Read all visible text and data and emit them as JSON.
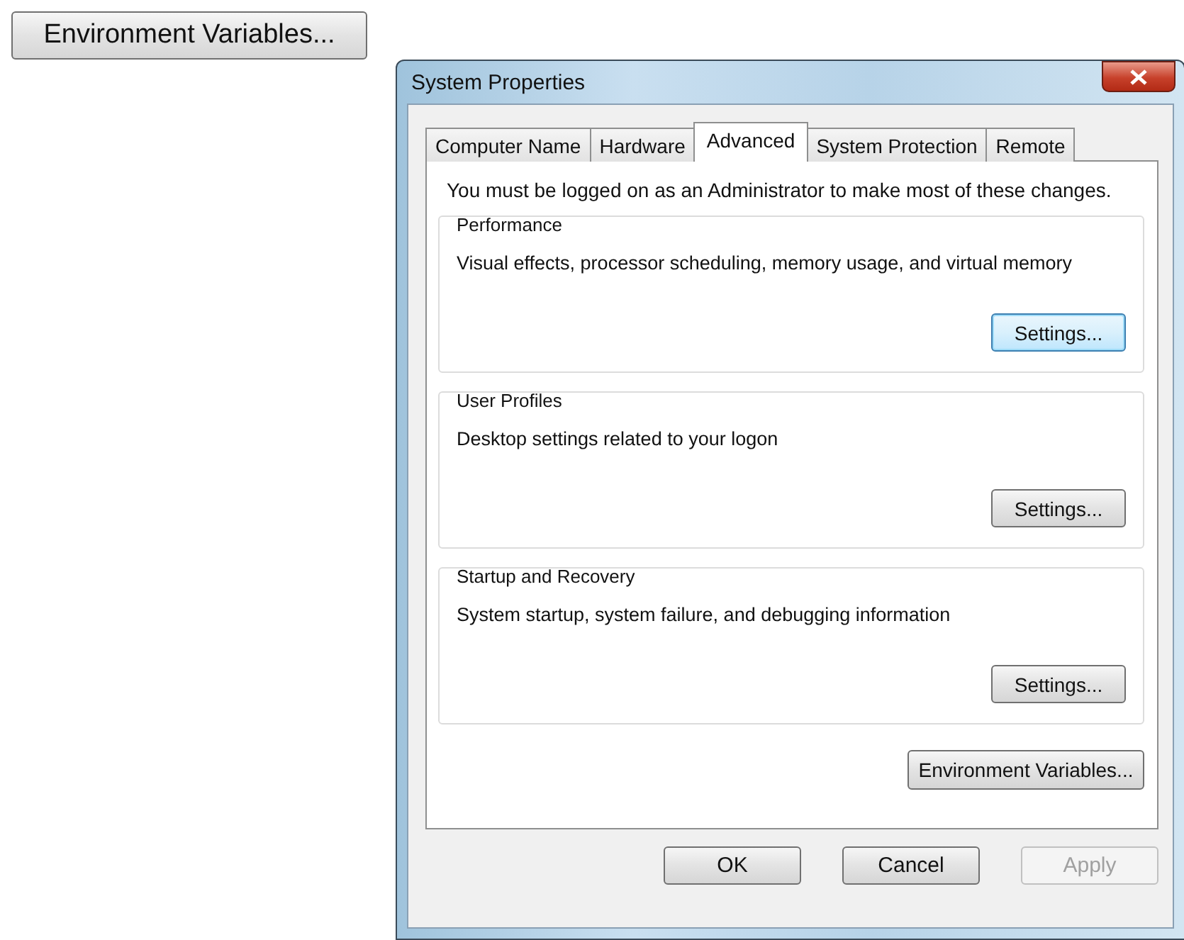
{
  "standalone_button": {
    "label": "Environment Variables..."
  },
  "window": {
    "title": "System Properties"
  },
  "tabs": [
    {
      "label": "Computer Name",
      "selected": false
    },
    {
      "label": "Hardware",
      "selected": false
    },
    {
      "label": "Advanced",
      "selected": true
    },
    {
      "label": "System Protection",
      "selected": false
    },
    {
      "label": "Remote",
      "selected": false
    }
  ],
  "notice": "You must be logged on as an Administrator to make most of these changes.",
  "groups": [
    {
      "title": "Performance",
      "description": "Visual effects, processor scheduling, memory usage, and virtual memory",
      "button": "Settings...",
      "focused": true
    },
    {
      "title": "User Profiles",
      "description": "Desktop settings related to your logon",
      "button": "Settings...",
      "focused": false
    },
    {
      "title": "Startup and Recovery",
      "description": "System startup, system failure, and debugging information",
      "button": "Settings...",
      "focused": false
    }
  ],
  "environment_button": "Environment Variables...",
  "buttons": [
    {
      "label": "OK",
      "disabled": false
    },
    {
      "label": "Cancel",
      "disabled": false
    },
    {
      "label": "Apply",
      "disabled": true
    }
  ]
}
